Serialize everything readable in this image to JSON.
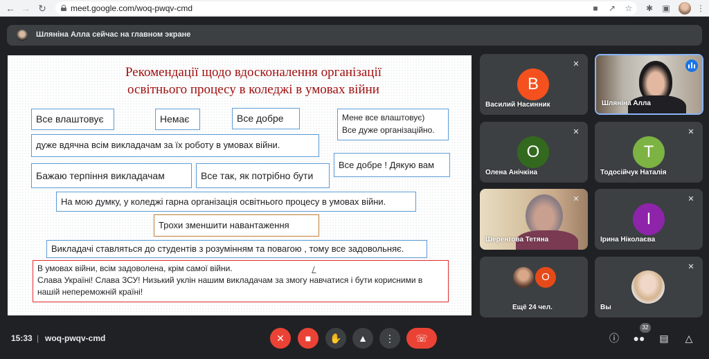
{
  "browser": {
    "url": "meet.google.com/woq-pwqv-cmd",
    "back_icon": "arrow-left",
    "forward_icon": "arrow-right",
    "reload_icon": "reload"
  },
  "presenter": {
    "text": "Шляніна Алла сейчас на главном экране"
  },
  "slide": {
    "title_line1": "Рекомендації щодо вдосконалення організації",
    "title_line2": "освітнього процесу в коледжі в умовах війни",
    "notes": [
      "Все влаштовує",
      "Немає",
      "Все добре",
      "Мене все влаштовує)",
      "Все дуже організаційно.",
      "дуже вдячна всім викладачам за їх роботу в умовах війни.",
      "Бажаю терпіння викладачам",
      "Все так, як потрібно бути",
      "Все добре ! Дякую вам",
      "На мою думку, у коледжі гарна організація освітнього процесу в умовах війни.",
      "Трохи зменшити навантаження",
      "Викладачі ставляться до студентів з розумінням та повагою , тому все задовольняє.",
      "В умовах війни, всім задоволена, крім самої війни.",
      "Слава Україні! Слава ЗСУ! Низький уклін нашим викладачам за змогу навчатися і бути корисними в нашій непереможній країні!"
    ]
  },
  "participants": [
    {
      "name": "Василий Насинник",
      "initial": "В",
      "color": "#f4511e",
      "muted": true
    },
    {
      "name": "Шляніна Алла",
      "speaking": true
    },
    {
      "name": "Олена Анічкіна",
      "initial": "О",
      "color": "#33691e",
      "muted": true
    },
    {
      "name": "Тодосійчук Наталія",
      "initial": "Т",
      "color": "#7cb342",
      "muted": true
    },
    {
      "name": "Шеренгова Тетяна",
      "muted": true
    },
    {
      "name": "Ірина Ніколаєва",
      "initial": "І",
      "color": "#8e24aa",
      "muted": true
    },
    {
      "more_label": "Ещё 24 чел.",
      "more_initial": "О",
      "more_color": "#e64a19"
    },
    {
      "name": "Вы",
      "muted": true
    }
  ],
  "bottom": {
    "time": "15:33",
    "separator": "|",
    "meeting_code": "woq-pwqv-cmd",
    "participants_count": "32"
  },
  "colors": {
    "accent": "#8ab4f8",
    "end_call": "#ea4335",
    "speaking": "#1a73e8"
  }
}
